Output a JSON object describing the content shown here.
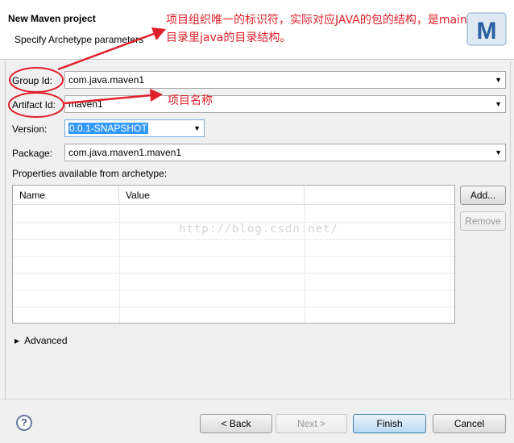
{
  "header": {
    "title": "New Maven project",
    "subtitle": "Specify Archetype parameters"
  },
  "form": {
    "group_id": {
      "label": "Group Id:",
      "value": "com.java.maven1"
    },
    "artifact_id": {
      "label": "Artifact Id:",
      "value": "maven1"
    },
    "version": {
      "label": "Version:",
      "value": "0.0.1-SNAPSHOT"
    },
    "package": {
      "label": "Package:",
      "value": "com.java.maven1.maven1"
    }
  },
  "properties": {
    "label": "Properties available from archetype:",
    "columns": [
      "Name",
      "Value"
    ],
    "add_label": "Add...",
    "remove_label": "Remove"
  },
  "advanced_label": "Advanced",
  "buttons": {
    "back": "< Back",
    "next": "Next >",
    "finish": "Finish",
    "cancel": "Cancel"
  },
  "help_icon": "?",
  "annotations": {
    "group_note_line1": "项目组织唯一的标识符，实际对应JAVA的包的结构，是main",
    "group_note_line2": "目录里java的目录结构。",
    "artifact_note": "项目名称"
  },
  "watermark": "http://blog.csdn.net/",
  "colors": {
    "annotation": "#e0202a",
    "selection": "#3399ff"
  }
}
